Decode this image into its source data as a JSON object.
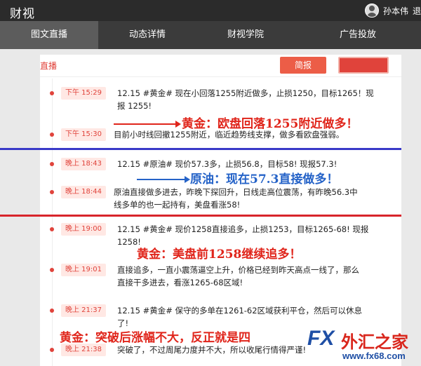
{
  "header": {
    "brand": "财视",
    "user_name": "孙本伟",
    "logout": "退"
  },
  "nav": {
    "tabs": [
      {
        "label": "图文直播",
        "active": true
      },
      {
        "label": "动态详情",
        "active": false
      },
      {
        "label": "财视学院",
        "active": false
      },
      {
        "label": "广告投放",
        "active": false
      }
    ]
  },
  "panel": {
    "live_label": "直播",
    "report_button": "简报"
  },
  "entries": [
    {
      "time": "下午 15:29",
      "lines": [
        "12.15 #黄金# 现在小回落1255附近做多，止损1250，目标1265！现",
        "报 1255!"
      ]
    },
    {
      "time": "下午 15:30",
      "lines": [
        "目前小时线回撤1255附近，临近趋势线支撑，做多看欧盘强弱。"
      ]
    },
    {
      "time": "晚上 18:43",
      "lines": [
        "12.15 #原油# 现价57.3多，止损56.8，目标58! 现报57.3!"
      ]
    },
    {
      "time": "晚上 18:44",
      "lines": [
        "原油直接做多进去，昨晚下探回升，日线走高位震荡，有昨晚56.3中",
        "线多单的也一起持有，美盘看涨58!"
      ]
    },
    {
      "time": "晚上 19:00",
      "lines": [
        "12.15 #黄金# 现价1258直接追多，止损1253，目标1265-68! 现报1258!"
      ]
    },
    {
      "time": "晚上 19:01",
      "lines": [
        "直接追多，一直小震荡逼空上升，价格已经到昨天高点一线了，那么",
        "直接干多进去，看涨1265-68区域!"
      ]
    },
    {
      "time": "晚上 21:37",
      "lines": [
        "12.15 #黄金# 保守的多单在1261-62区域获利平仓，然后可以休息",
        "了!"
      ]
    },
    {
      "time": "晚上 21:38",
      "lines": [
        "突破了，不过周尾力度并不大，所以收尾行情得严谨!"
      ]
    }
  ],
  "annotations": {
    "gold_1": "黄金：欧盘回落1255附近做多！",
    "oil": "原油：现在57.3直接做多！",
    "gold_2": "黄金：美盘前1258继续追多！",
    "gold_3": "黄金：突破后涨幅不大，反正就是四"
  },
  "watermark": {
    "fx": "FX",
    "cn": "外汇之家",
    "url": "www.fx68.com"
  },
  "colors": {
    "accent_red": "#e0433b",
    "annotation_red": "#e0251b",
    "annotation_blue": "#2563c8",
    "nav_bg": "#3b3b3b",
    "topbar_bg": "#2b2b2b"
  }
}
